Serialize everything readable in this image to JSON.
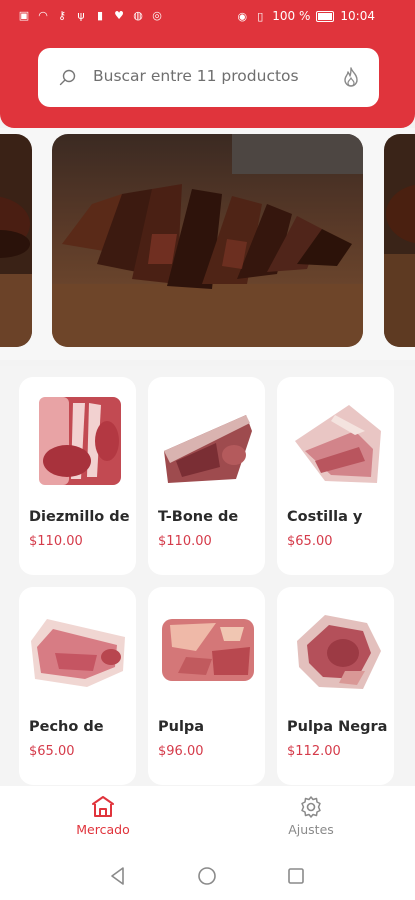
{
  "status_bar": {
    "battery_percent": "100 %",
    "time": "10:04"
  },
  "search": {
    "placeholder": "Buscar entre 11 productos"
  },
  "products": [
    {
      "name": "Diezmillo de",
      "price": "$110.00"
    },
    {
      "name": "T-Bone de",
      "price": "$110.00"
    },
    {
      "name": "Costilla y",
      "price": "$65.00"
    },
    {
      "name": "Pecho de",
      "price": "$65.00"
    },
    {
      "name": "Pulpa",
      "price": "$96.00"
    },
    {
      "name": "Pulpa Negra",
      "price": "$112.00"
    }
  ],
  "bottom_nav": {
    "mercado": "Mercado",
    "ajustes": "Ajustes"
  },
  "colors": {
    "brand_red": "#e0343c",
    "price_red": "#d53b4a",
    "inactive_gray": "#8a8a8a"
  }
}
